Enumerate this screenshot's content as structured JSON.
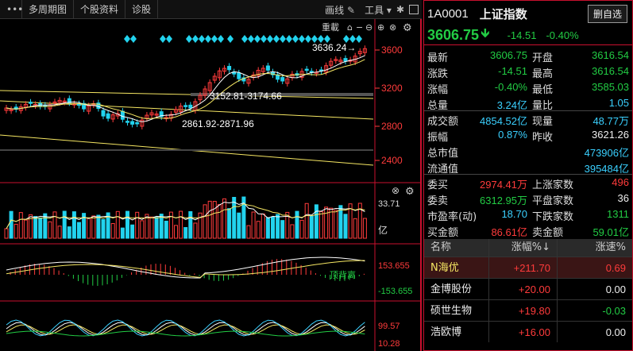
{
  "toolbar": {
    "menu_icon": "menu-dots-icon",
    "tabs": [
      "多周期图",
      "个股资料",
      "诊股"
    ],
    "draw_label": "画线",
    "tools_label": "工具"
  },
  "chart": {
    "reweight_label": "重載",
    "price_axis": [
      "3600",
      "3200",
      "2800",
      "2400"
    ],
    "high_annot": "3636.24→",
    "range_annot_1": "3152.81-3174.66",
    "range_annot_2": "2861.92-2871.96",
    "volume_axis_top": "33.71",
    "volume_unit": "亿",
    "macd_axis_top": "153.655",
    "macd_axis_bottom": "-153.655",
    "macd_label": "顶背离",
    "kdj_axis_top": "99.57",
    "kdj_axis_bottom": "10.28",
    "colors": {
      "up": "#ff3b3b",
      "down": "#22d3ee",
      "ma5": "#ffffff",
      "ma10": "#f5e663",
      "accent": "#c8102e"
    }
  },
  "quote": {
    "code": "1A0001",
    "name": "上证指数",
    "fav_button": "删自选",
    "price": "3606.75",
    "change": "-14.51",
    "change_pct": "-0.40%",
    "rows": [
      {
        "l1": "最新",
        "v1": "3606.75",
        "c1": "green",
        "l2": "开盘",
        "v2": "3616.54",
        "c2": "green"
      },
      {
        "l1": "涨跌",
        "v1": "-14.51",
        "c1": "green",
        "l2": "最高",
        "v2": "3616.54",
        "c2": "green"
      },
      {
        "l1": "涨幅",
        "v1": "-0.40%",
        "c1": "green",
        "l2": "最低",
        "v2": "3585.03",
        "c2": "green"
      },
      {
        "l1": "总量",
        "v1": "3.24亿",
        "c1": "cyan",
        "l2": "量比",
        "v2": "1.05",
        "c2": "cyan"
      },
      {
        "l1": "成交额",
        "v1": "4854.52亿",
        "c1": "cyan",
        "l2": "现量",
        "v2": "48.77万",
        "c2": "cyan"
      },
      {
        "l1": "振幅",
        "v1": "0.87%",
        "c1": "cyan",
        "l2": "昨收",
        "v2": "3621.26",
        "c2": "white"
      },
      {
        "l1": "总市值",
        "v1": "",
        "c1": "white",
        "l2": "",
        "v2": "473906亿",
        "c2": "cyan"
      },
      {
        "l1": "流通值",
        "v1": "",
        "c1": "white",
        "l2": "",
        "v2": "395484亿",
        "c2": "cyan"
      },
      {
        "l1": "委买",
        "v1": "2974.41万",
        "c1": "red",
        "l2": "上涨家数",
        "v2": "496",
        "c2": "red"
      },
      {
        "l1": "委卖",
        "v1": "6312.95万",
        "c1": "green",
        "l2": "平盘家数",
        "v2": "36",
        "c2": "white"
      },
      {
        "l1": "市盈率(动)",
        "v1": "18.70",
        "c1": "cyan",
        "l2": "下跌家数",
        "v2": "1311",
        "c2": "green"
      },
      {
        "l1": "买金额",
        "v1": "86.61亿",
        "c1": "red",
        "l2": "卖金额",
        "v2": "59.01亿",
        "c2": "green"
      }
    ]
  },
  "ranking": {
    "headers": [
      "名称",
      "涨幅%↓",
      "涨速%"
    ],
    "rows": [
      {
        "name": "N海优",
        "pct": "+211.70",
        "speed": "0.69",
        "speed_color": "red"
      },
      {
        "name": "金博股份",
        "pct": "+20.00",
        "speed": "0.00",
        "speed_color": "white"
      },
      {
        "name": "硕世生物",
        "pct": "+19.80",
        "speed": "-0.03",
        "speed_color": "green"
      },
      {
        "name": "浩欧博",
        "pct": "+16.00",
        "speed": "0.00",
        "speed_color": "white"
      }
    ]
  }
}
